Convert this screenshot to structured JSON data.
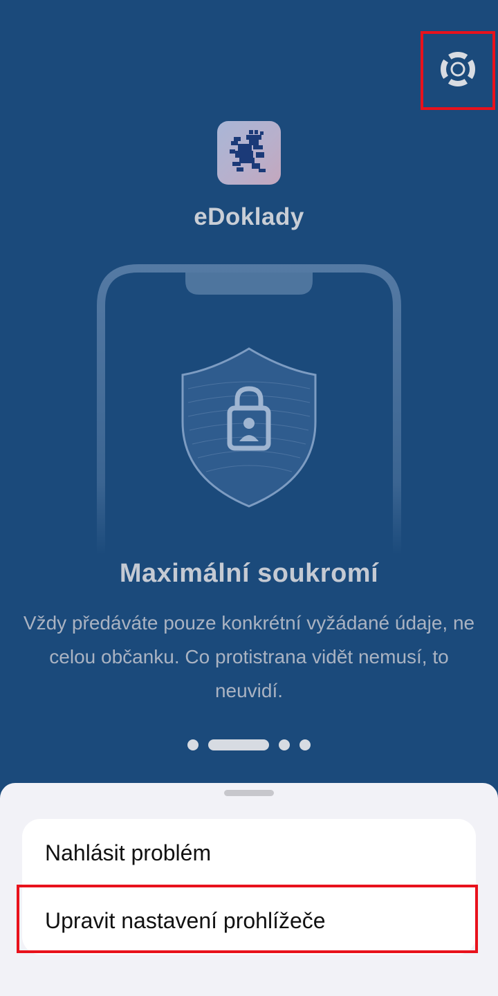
{
  "app": {
    "name": "eDoklady"
  },
  "icons": {
    "help": "lifebuoy-icon",
    "logo": "czech-lion-icon",
    "hero": "shield-lock-icon"
  },
  "onboarding": {
    "title": "Maximální soukromí",
    "description": "Vždy předáváte pouze konkrétní vyžádané údaje, ne celou občanku. Co protistrana vidět nemusí, to neuvidí.",
    "page_count": 4,
    "active_page": 2
  },
  "sheet": {
    "items": [
      {
        "label": "Nahlásit problém"
      },
      {
        "label": "Upravit nastavení prohlížeče"
      }
    ]
  },
  "colors": {
    "background": "#1b4a7b",
    "highlight": "#e8121c",
    "sheet_bg": "#f2f2f7"
  }
}
